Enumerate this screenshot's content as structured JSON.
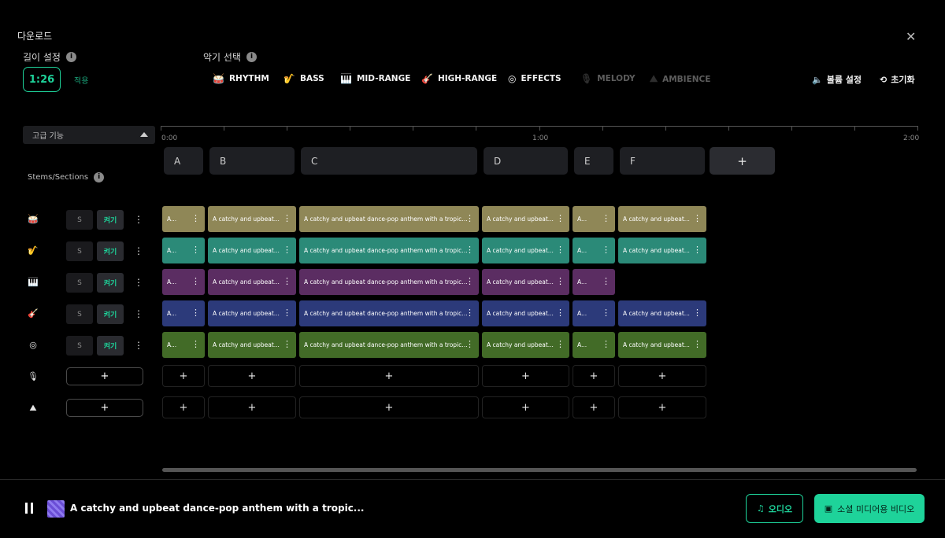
{
  "dialog": {
    "title": "다운로드"
  },
  "length": {
    "label": "길이 설정",
    "value": "1:26",
    "apply": "적용"
  },
  "instruments": {
    "label": "악기 선택",
    "items": [
      {
        "name": "RHYTHM",
        "icon": "drum-icon",
        "glyph": "🥁",
        "enabled": true
      },
      {
        "name": "BASS",
        "icon": "bass-icon",
        "glyph": "🎷",
        "enabled": true
      },
      {
        "name": "MID-RANGE",
        "icon": "piano-icon",
        "glyph": "🎹",
        "enabled": true
      },
      {
        "name": "HIGH-RANGE",
        "icon": "guitar-icon",
        "glyph": "🎸",
        "enabled": true
      },
      {
        "name": "EFFECTS",
        "icon": "target-icon",
        "glyph": "◎",
        "enabled": true
      },
      {
        "name": "MELODY",
        "icon": "mic-icon",
        "glyph": "🎙",
        "enabled": false
      },
      {
        "name": "AMBIENCE",
        "icon": "landscape-icon",
        "glyph": "⛰",
        "enabled": false
      }
    ]
  },
  "toolbar": {
    "volume": "볼륨 설정",
    "reset": "초기화"
  },
  "advanced": {
    "label": "고급 기능"
  },
  "stems_label": "Stems/Sections",
  "timeline": {
    "labels": [
      "0:00",
      "1:00",
      "2:00"
    ]
  },
  "sections": [
    "A",
    "B",
    "C",
    "D",
    "E",
    "F",
    "+"
  ],
  "stem_buttons": {
    "solo": "S",
    "on": "켜기"
  },
  "clip_text_short": "A...",
  "clip_text_mid": "A catchy and upbeat...",
  "clip_text_long": "A catchy and upbeat dance-pop anthem with a tropical...",
  "colors": {
    "rhythm": "#8f8757",
    "bass": "#2b8a78",
    "mid": "#5b2d62",
    "high": "#2c3a7a",
    "effects": "#426b27",
    "accent": "#1ed39a"
  },
  "player": {
    "now_playing": "A catchy and upbeat dance-pop anthem with a tropic...",
    "audio_btn": "오디오",
    "video_btn": "소셜 미디어용 비디오"
  },
  "add_symbol": "+"
}
